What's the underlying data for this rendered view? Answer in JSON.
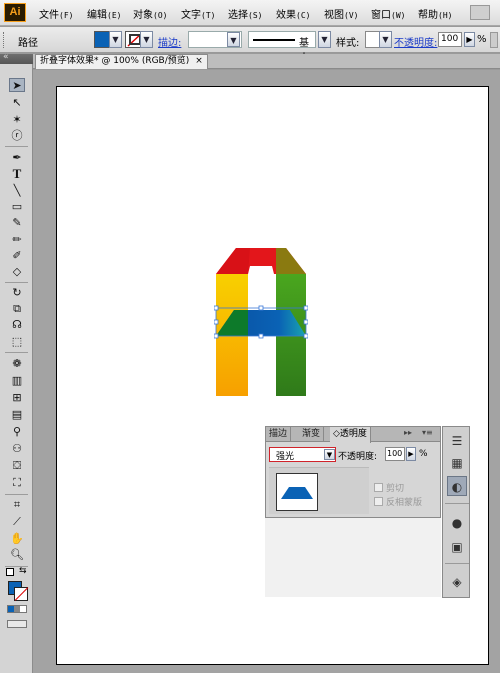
{
  "app": {
    "logo": "Ai"
  },
  "menu": [
    {
      "label": "文件",
      "key": "(F)"
    },
    {
      "label": "编辑",
      "key": "(E)"
    },
    {
      "label": "对象",
      "key": "(O)"
    },
    {
      "label": "文字",
      "key": "(T)"
    },
    {
      "label": "选择",
      "key": "(S)"
    },
    {
      "label": "效果",
      "key": "(C)"
    },
    {
      "label": "视图",
      "key": "(V)"
    },
    {
      "label": "窗口",
      "key": "(W)"
    },
    {
      "label": "帮助",
      "key": "(H)"
    }
  ],
  "control_bar": {
    "selection_label": "路径",
    "stroke_link": "描边:",
    "line_profile": "基本",
    "style_label": "样式:",
    "opacity_link": "不透明度:",
    "opacity_value": "100",
    "percent": "%",
    "fill_color": "#0a62b5",
    "dropdown_arrow": "▼",
    "forward_arrow": "▶"
  },
  "document_tab": {
    "title": "折叠字体效果* @ 100% (RGB/预览)",
    "close": "×"
  },
  "transparency_panel": {
    "tabs": [
      "描边",
      "渐变",
      "◇透明度"
    ],
    "active_tab": 2,
    "tab_arrows": "▸▸",
    "menu_icon": "▾≡",
    "blend_mode": "强光",
    "opacity_label": "不透明度:",
    "opacity_value": "100",
    "percent": "%",
    "clip_label": "剪切",
    "invert_mask_label": "反相蒙版"
  },
  "colors": {
    "red": "#e3161b",
    "red_dark": "#b10e12",
    "olive": "#8a7a10",
    "yellow": "#f6c400",
    "orange": "#f7a400",
    "green": "#3c9a1e",
    "green_dark": "#2f7a18",
    "blue": "#0a62b5",
    "teal": "#1a9aa8",
    "selection": "#3a78d8"
  }
}
